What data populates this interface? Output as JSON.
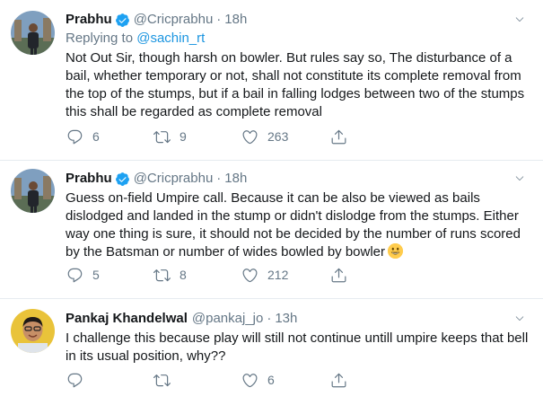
{
  "colors": {
    "accent": "#1da1f2",
    "link": "#1b95e0",
    "muted": "#657786",
    "text": "#14171a",
    "divider": "#e6ecf0"
  },
  "tweets": [
    {
      "name": "Prabhu",
      "verified": true,
      "handle": "@Cricprabhu",
      "dot": "·",
      "time": "18h",
      "replying_prefix": "Replying to ",
      "replying_to": "@sachin_rt",
      "text": "Not Out Sir, though harsh on bowler. But rules say so, The disturbance of a bail, whether temporary or not, shall not constitute its complete removal from the top of the stumps, but if a bail in falling lodges between two of the stumps this shall be regarded as complete removal",
      "reply_count": "6",
      "retweet_count": "9",
      "like_count": "263",
      "icons": [
        "reply-icon",
        "retweet-icon",
        "like-icon",
        "share-icon"
      ]
    },
    {
      "name": "Prabhu",
      "verified": true,
      "handle": "@Cricprabhu",
      "dot": "·",
      "time": "18h",
      "text": "Guess on-field Umpire call. Because it can be also be viewed as bails dislodged and landed in the stump or didn't dislodge from the stumps. Either way one thing is sure, it  should not be decided by the number of runs scored by the Batsman or number of wides bowled by bowler",
      "emoji": "grinning-face",
      "reply_count": "5",
      "retweet_count": "8",
      "like_count": "212",
      "icons": [
        "reply-icon",
        "retweet-icon",
        "like-icon",
        "share-icon"
      ]
    },
    {
      "name": "Pankaj Khandelwal",
      "verified": false,
      "handle": "@pankaj_jo",
      "dot": "·",
      "time": "13h",
      "text": "I challenge this because play will still not continue untill umpire keeps that bell in its usual position, why??",
      "reply_count": "",
      "retweet_count": "",
      "like_count": "6",
      "icons": [
        "reply-icon",
        "retweet-icon",
        "like-icon",
        "share-icon"
      ]
    }
  ]
}
